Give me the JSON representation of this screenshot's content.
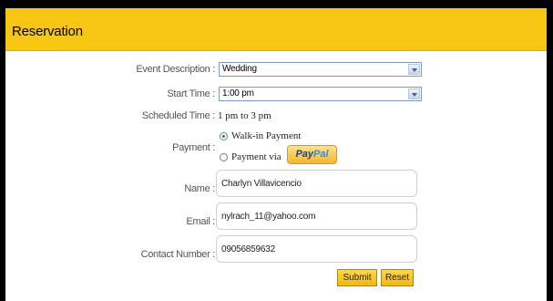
{
  "header": {
    "title": "Reservation"
  },
  "form": {
    "event_description": {
      "label": "Event Description :",
      "value": "Wedding"
    },
    "start_time": {
      "label": "Start Time :",
      "value": "1:00 pm"
    },
    "scheduled_time": {
      "label": "Scheduled Time :",
      "value": "1 pm to 3 pm"
    },
    "payment": {
      "label": "Payment :",
      "options": [
        {
          "label": "Walk-in Payment",
          "checked": true
        },
        {
          "label": "Payment via",
          "checked": false
        }
      ],
      "paypal": {
        "pay": "Pay",
        "pal": "Pal"
      }
    },
    "name": {
      "label": "Name :",
      "value": "Charlyn Villavicencio"
    },
    "email": {
      "label": "Email :",
      "value": "nylrach_11@yahoo.com"
    },
    "contact": {
      "label": "Contact Number :",
      "value": "09056859632"
    }
  },
  "buttons": {
    "submit": "Submit",
    "reset": "Reset"
  },
  "colors": {
    "header": "#f7c613",
    "button": "#f3b710",
    "border": "#000000"
  }
}
